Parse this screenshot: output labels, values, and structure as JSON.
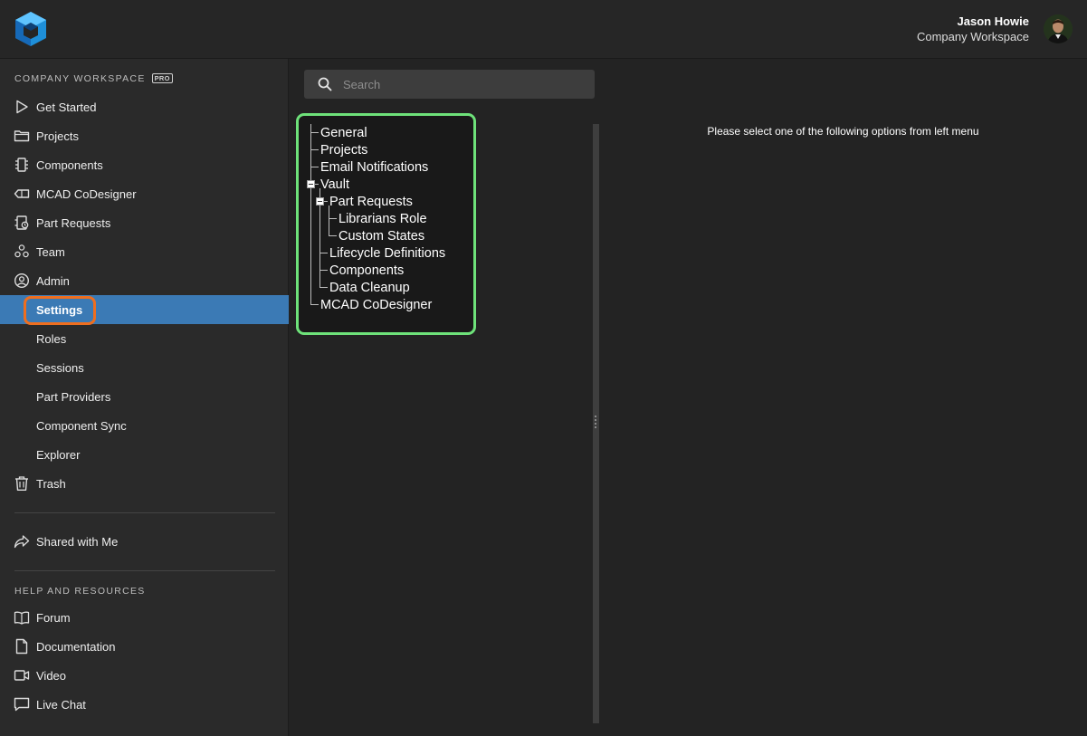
{
  "header": {
    "logo_icon": "altium-365-logo-icon",
    "user_name": "Jason Howie",
    "workspace": "Company Workspace",
    "avatar_icon": "user-avatar"
  },
  "sidebar": {
    "section_label": "COMPANY WORKSPACE",
    "pro_badge": "PRO",
    "items": [
      {
        "label": "Get Started",
        "icon": "play-icon"
      },
      {
        "label": "Projects",
        "icon": "folder-icon"
      },
      {
        "label": "Components",
        "icon": "chip-icon"
      },
      {
        "label": "MCAD CoDesigner",
        "icon": "mcad-icon"
      },
      {
        "label": "Part Requests",
        "icon": "part-request-icon"
      },
      {
        "label": "Team",
        "icon": "team-icon"
      },
      {
        "label": "Admin",
        "icon": "user-circle-icon"
      }
    ],
    "admin_subitems": [
      {
        "label": "Settings",
        "active": true
      },
      {
        "label": "Roles"
      },
      {
        "label": "Sessions"
      },
      {
        "label": "Part Providers"
      },
      {
        "label": "Component Sync"
      },
      {
        "label": "Explorer"
      }
    ],
    "trash": {
      "label": "Trash",
      "icon": "trash-icon"
    },
    "shared": {
      "label": "Shared with Me",
      "icon": "share-arrow-icon"
    },
    "help_label": "HELP AND RESOURCES",
    "help_items": [
      {
        "label": "Forum",
        "icon": "book-icon"
      },
      {
        "label": "Documentation",
        "icon": "document-icon"
      },
      {
        "label": "Video",
        "icon": "video-icon"
      },
      {
        "label": "Live Chat",
        "icon": "chat-icon"
      }
    ]
  },
  "main": {
    "search": {
      "placeholder": "Search",
      "value": ""
    },
    "tree": [
      {
        "label": "General"
      },
      {
        "label": "Projects"
      },
      {
        "label": "Email Notifications"
      },
      {
        "label": "Vault",
        "expanded": true
      },
      {
        "label": "Part Requests",
        "expanded": true
      },
      {
        "label": "Librarians Role"
      },
      {
        "label": "Custom States"
      },
      {
        "label": "Lifecycle Definitions"
      },
      {
        "label": "Components"
      },
      {
        "label": "Data Cleanup"
      },
      {
        "label": "MCAD CoDesigner"
      }
    ],
    "prompt": "Please select one of the following options from left menu"
  },
  "colors": {
    "active_bg": "#3b7ab5",
    "focus_orange": "#ee6e1f",
    "tree_highlight_green": "#6ee27a"
  }
}
